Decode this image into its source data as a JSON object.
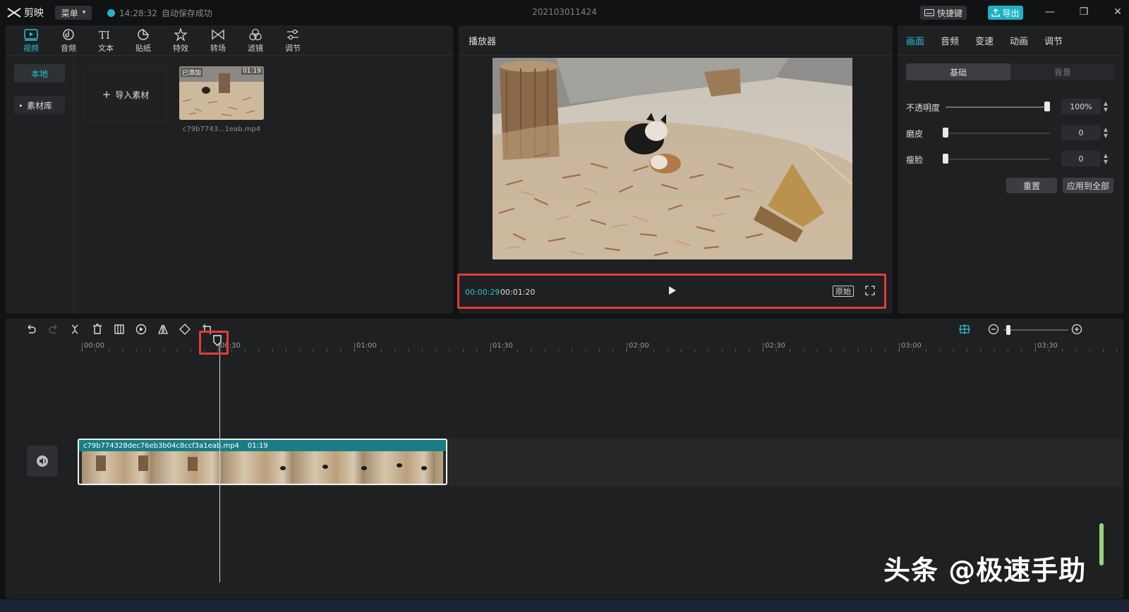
{
  "app": {
    "name": "剪映",
    "menu_label": "菜单",
    "save_time": "14:28:32",
    "save_status": "自动保存成功",
    "project_title": "202103011424",
    "shortcut_label": "快捷键",
    "export_label": "导出"
  },
  "colors": {
    "accent": "#29c1cf",
    "highlight_box": "#e23b3b",
    "clip_header": "#197d86"
  },
  "media": {
    "tools": [
      {
        "label": "视频",
        "icon": "video-icon"
      },
      {
        "label": "音频",
        "icon": "audio-icon"
      },
      {
        "label": "文本",
        "icon": "text-icon"
      },
      {
        "label": "贴纸",
        "icon": "sticker-icon"
      },
      {
        "label": "特效",
        "icon": "effects-icon"
      },
      {
        "label": "转场",
        "icon": "transition-icon"
      },
      {
        "label": "滤镜",
        "icon": "filter-icon"
      },
      {
        "label": "调节",
        "icon": "adjust-icon"
      }
    ],
    "active_tool": "视频",
    "side": {
      "local": "本地",
      "library": "素材库"
    },
    "import_label": "导入素材",
    "thumb": {
      "badge_left": "已添加",
      "duration": "01:19",
      "name": "c79b7743...1eab.mp4"
    }
  },
  "player": {
    "title": "播放器",
    "current_time": "00:00:29",
    "total_time": "00:01:20",
    "original_label": "原始"
  },
  "props": {
    "tabs": [
      "画面",
      "音频",
      "变速",
      "动画",
      "调节"
    ],
    "active_tab": "画面",
    "seg": {
      "basic": "基础",
      "background": "背景"
    },
    "opacity": {
      "label": "不透明度",
      "value": "100%",
      "level": 1.0
    },
    "smooth": {
      "label": "磨皮",
      "value": "0",
      "level": 0.0
    },
    "slim": {
      "label": "瘦脸",
      "value": "0",
      "level": 0.0
    },
    "reset_label": "重置",
    "apply_all_label": "应用到全部"
  },
  "timeline": {
    "ruler_labels": [
      "00:00",
      "00:30",
      "01:00",
      "01:30",
      "02:00",
      "02:30",
      "03:00",
      "03:30"
    ],
    "playhead_time": "00:29",
    "clip": {
      "name": "c79b774328dec76eb3b04c8ccf3a1eab.mp4",
      "duration": "01:19"
    }
  },
  "watermark": "头条 @极速手助"
}
